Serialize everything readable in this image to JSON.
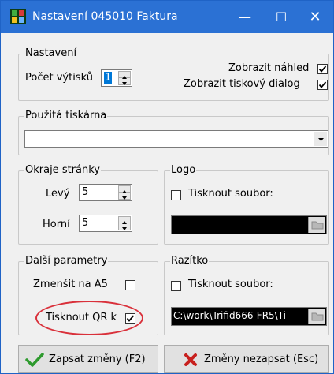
{
  "window": {
    "title": "Nastavení 045010 Faktura",
    "minimize_glyph": "—",
    "maximize_glyph": "☐",
    "close_glyph": "✕",
    "icon": "app-grid-icon"
  },
  "nastaveni": {
    "legend": "Nastavení",
    "pocet_label": "Počet výtisků",
    "pocet_value": "1",
    "nahled_label": "Zobrazit náhled",
    "nahled_checked": true,
    "dialog_label": "Zobrazit tiskový dialog",
    "dialog_checked": true
  },
  "tiskarna": {
    "legend": "Použitá tiskárna",
    "value": ""
  },
  "okraje": {
    "legend": "Okraje stránky",
    "levy_label": "Levý",
    "levy_value": "5",
    "horni_label": "Horní",
    "horni_value": "5"
  },
  "logo": {
    "legend": "Logo",
    "tisknout_label": "Tisknout soubor:",
    "tisknout_checked": false,
    "path": ""
  },
  "dalsi": {
    "legend": "Další parametry",
    "zmensit_label": "Zmenšit na A5",
    "zmensit_checked": false,
    "qr_label": "Tisknout QR k",
    "qr_checked": true
  },
  "razitko": {
    "legend": "Razítko",
    "tisknout_label": "Tisknout soubor:",
    "tisknout_checked": false,
    "path": "C:\\work\\Trifid666-FR5\\Ti"
  },
  "buttons": {
    "save_label": "Zapsat změny (F2)",
    "cancel_label": "Změny nezapsat (Esc)"
  },
  "colors": {
    "titlebar": "#2b71d4",
    "highlight": "#d9303a",
    "save_check": "#2e9a2e",
    "cancel_x": "#c8201e"
  }
}
